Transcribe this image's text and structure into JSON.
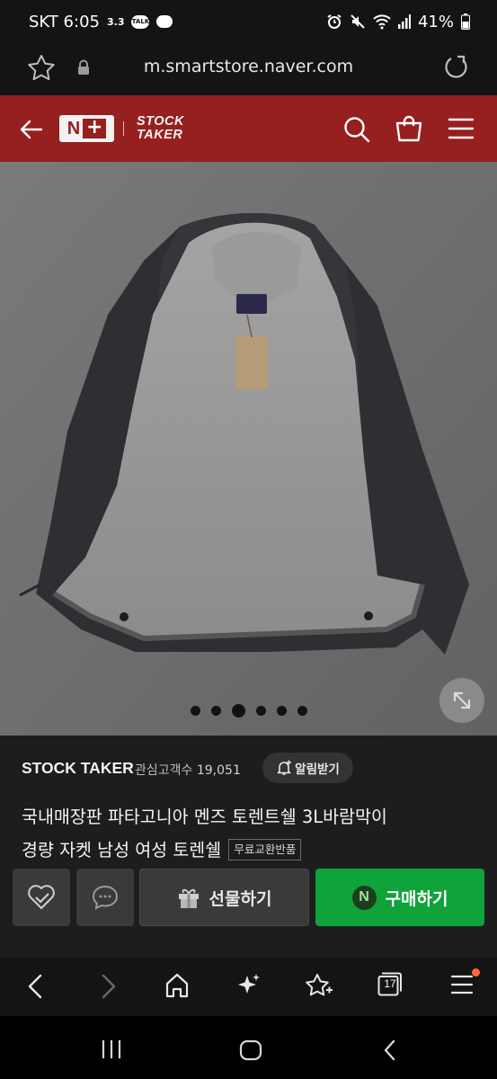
{
  "status": {
    "carrier_time": "SKT 6:05",
    "speed": "3.3",
    "talk": "TALK",
    "battery": "41%"
  },
  "browser": {
    "url": "m.smartstore.naver.com",
    "tab_count": "17"
  },
  "header": {
    "logo_n": "N",
    "logo_plus": "+",
    "logo_line1": "STOCK",
    "logo_line2": "TAKER"
  },
  "gallery": {
    "image_count": 6,
    "active_index": 2
  },
  "store": {
    "name": "STOCK TAKER",
    "followers_label": "관심고객수",
    "followers_count": "19,051",
    "alarm_label": "알림받기"
  },
  "product": {
    "title_line1": "국내매장판 파타고니아 멘즈 토렌트쉘 3L바람막이",
    "title_line2": "경량 자켓 남성 여성 토렌쉘",
    "badge": "무료교환반품"
  },
  "actions": {
    "gift_label": "선물하기",
    "buy_label": "구매하기",
    "buy_icon_letter": "N"
  },
  "colors": {
    "header_red": "#961f1f",
    "buy_green": "#0fa33a"
  }
}
